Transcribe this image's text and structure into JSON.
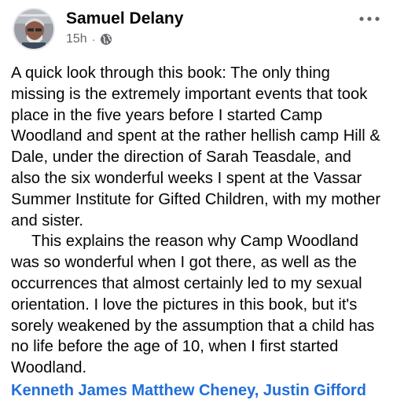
{
  "post": {
    "author": "Samuel Delany",
    "timestamp": "15h",
    "separator": "·",
    "audience_icon": "globe-icon",
    "more_icon": "more-options-icon",
    "paragraphs": [
      "A quick look through this book: The only thing missing is the extremely important events that took place in the five years before I started Camp Woodland and spent at the rather hellish camp Hill & Dale, under the direction of Sarah Teasdale, and also the six wonderful weeks I spent at the Vassar Summer Institute for Gifted Children, with my mother and sister.",
      "This explains the reason why Camp Woodland was so wonderful when I got there, as well as the occurrences that almost certainly led to my sexual orientation. I love the pictures in this book, but it's sorely weakened by the assumption that a child has no life before the age of 10, when I first started Woodland."
    ],
    "tagged_people": "Kenneth James Matthew Cheney, Justin Gifford"
  },
  "colors": {
    "name_text": "#050505",
    "meta_text": "#65676b",
    "link_blue": "#216fdb",
    "background": "#ffffff"
  }
}
